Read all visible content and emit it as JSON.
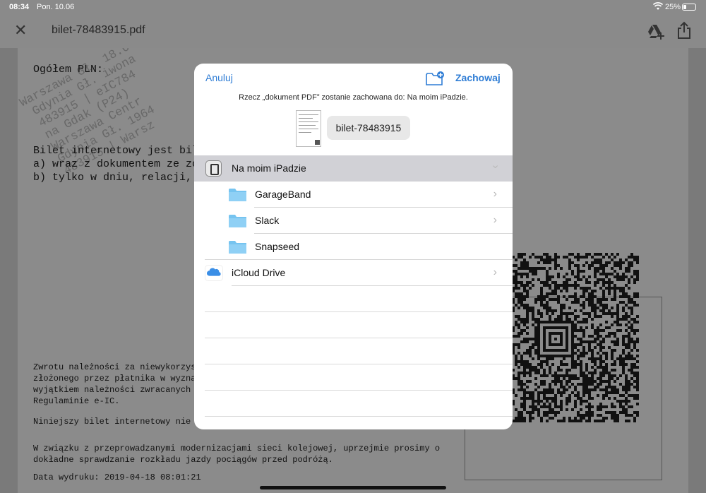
{
  "status_bar": {
    "time": "08:34",
    "date": "Pon. 10.06",
    "battery": "25%"
  },
  "toolbar": {
    "close_glyph": "✕",
    "title": "bilet-78483915.pdf",
    "icons": [
      "close-icon",
      "google-drive-add-icon",
      "share-icon"
    ]
  },
  "document": {
    "total_label": "Ogółem PLN:",
    "ticket_lines": [
      "Bilet internetowy jest bil",
      "a) wraz z dokumentem ze zo",
      "b) tylko w dniu, relacji,"
    ],
    "refund_lines": [
      "Zwrotu należności za niewykorzys",
      "złożonego przez płatnika w wyzna",
      "wyjątkiem należności zwracanych",
      "Regulaminie e-IC."
    ],
    "notice_line": "Niniejszy bilet internetowy nie",
    "modernization_lines": [
      "W związku z przeprowadzanymi modernizacjami sieci kolejowej, uprzejmie prosimy o",
      "dokładne sprawdzanie rozkładu jazdy pociągów przed podróżą."
    ],
    "print_date": "Data wydruku: 2019-04-18 08:01:21"
  },
  "save_dialog": {
    "cancel_label": "Anuluj",
    "save_label": "Zachowaj",
    "info_text": "Rzecz „dokument PDF” zostanie zachowana do: Na moim iPadzie.",
    "file_name": "bilet-78483915",
    "locations": [
      {
        "label": "Na moim iPadzie",
        "icon": "ipad-icon",
        "selected": true
      },
      {
        "label": "GarageBand",
        "icon": "folder-icon"
      },
      {
        "label": "Slack",
        "icon": "folder-icon"
      },
      {
        "label": "Snapseed",
        "icon": "folder-icon"
      },
      {
        "label": "iCloud Drive",
        "icon": "icloud-icon"
      }
    ]
  },
  "colors": {
    "accent": "#2f7dd5",
    "folder": "#76c4f0",
    "selected_row": "#d1d1d6"
  }
}
